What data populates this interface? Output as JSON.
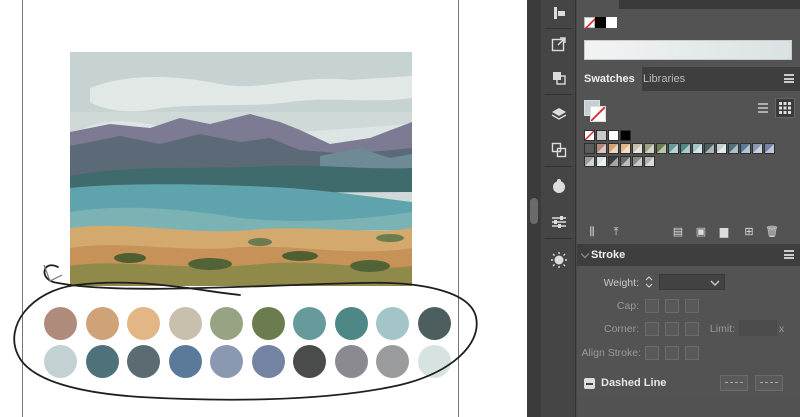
{
  "panels": {
    "tabs": [
      {
        "label": "Swatches",
        "active": true
      },
      {
        "label": "Libraries",
        "active": false
      }
    ],
    "stroke": {
      "title": "Stroke",
      "weight_label": "Weight:",
      "cap_label": "Cap:",
      "corner_label": "Corner:",
      "limit_label": "Limit:",
      "limit_unit": "x",
      "align_label": "Align Stroke:",
      "dashed_label": "Dashed Line"
    }
  },
  "palette_colors": [
    [
      "#b08a7a",
      "#cfa277",
      "#e2b785",
      "#c8c0ad",
      "#97a382",
      "#6b7d4f",
      "#679b9b",
      "#4e8886",
      "#a3c4c8",
      "#4d5e5e"
    ],
    [
      "#c4d1d3",
      "#4f7179",
      "#5a6c72",
      "#5b7a99",
      "#8b98b1",
      "#7483a3",
      "#4a4c4b",
      "#8b8a91",
      "#9a9b9d",
      "#d7e3e1"
    ]
  ],
  "swatch_grid_colors": [
    "#5a5a5a",
    "#b08a7a",
    "#cfa277",
    "#e2b785",
    "#c8c0ad",
    "#97a382",
    "#6b7d4f",
    "#679b9b",
    "#4e8886",
    "#a3c4c8",
    "#4d5e5e",
    "#c4d1d3",
    "#4f7179",
    "#5b7a99",
    "#8b98b1",
    "#7483a3",
    "#9a9b9d",
    "#d7e3e1"
  ],
  "colors": {
    "panel_bg": "#535353",
    "tab_bar": "#3e3e3e",
    "toolbar_bg": "#454545",
    "sketch_stroke": "#1e1e1e"
  }
}
